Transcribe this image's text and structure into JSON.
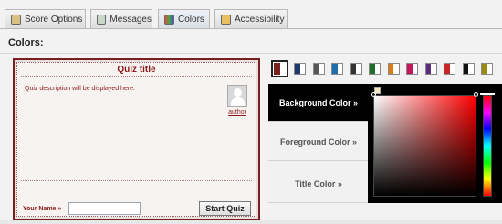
{
  "tabs": [
    {
      "label": "Score Options",
      "icon": "score-options-icon",
      "active": false
    },
    {
      "label": "Messages",
      "icon": "messages-icon",
      "active": false
    },
    {
      "label": "Colors",
      "icon": "colors-icon",
      "active": true
    },
    {
      "label": "Accessibility",
      "icon": "accessibility-icon",
      "active": false
    }
  ],
  "section_label": "Colors:",
  "preview": {
    "title": "Quiz title",
    "description": "Quiz description will be displayed here.",
    "author_link": "author",
    "name_label": "Your Name »",
    "name_value": "",
    "start_button": "Start Quiz"
  },
  "swatches": [
    {
      "left": "#7a1f1f",
      "right": "#ffffff",
      "selected": true
    },
    {
      "left": "#1f3a6a",
      "right": "#ffffff",
      "selected": false
    },
    {
      "left": "#555555",
      "right": "#ffffff",
      "selected": false
    },
    {
      "left": "#1e6fb0",
      "right": "#ffffff",
      "selected": false
    },
    {
      "left": "#333333",
      "right": "#ffffff",
      "selected": false
    },
    {
      "left": "#1f6f2a",
      "right": "#ffffff",
      "selected": false
    },
    {
      "left": "#e07a10",
      "right": "#ffffff",
      "selected": false
    },
    {
      "left": "#c2185b",
      "right": "#ffffff",
      "selected": false
    },
    {
      "left": "#5a2d82",
      "right": "#ffffff",
      "selected": false
    },
    {
      "left": "#c62828",
      "right": "#ffffff",
      "selected": false
    },
    {
      "left": "#111111",
      "right": "#ffffff",
      "selected": false
    },
    {
      "left": "#9a8a10",
      "right": "#ffffff",
      "selected": false
    }
  ],
  "color_options": [
    {
      "label": "Background Color »",
      "active": true
    },
    {
      "label": "Foreground Color »",
      "active": false
    },
    {
      "label": "Title Color »",
      "active": false
    }
  ],
  "picker": {
    "current_color": "#f4e6c0",
    "hue": "#ff0000"
  },
  "colors": {
    "accent": "#7a1f1f",
    "text_accent": "#8b1a1a",
    "active_option_bg": "#000000"
  }
}
